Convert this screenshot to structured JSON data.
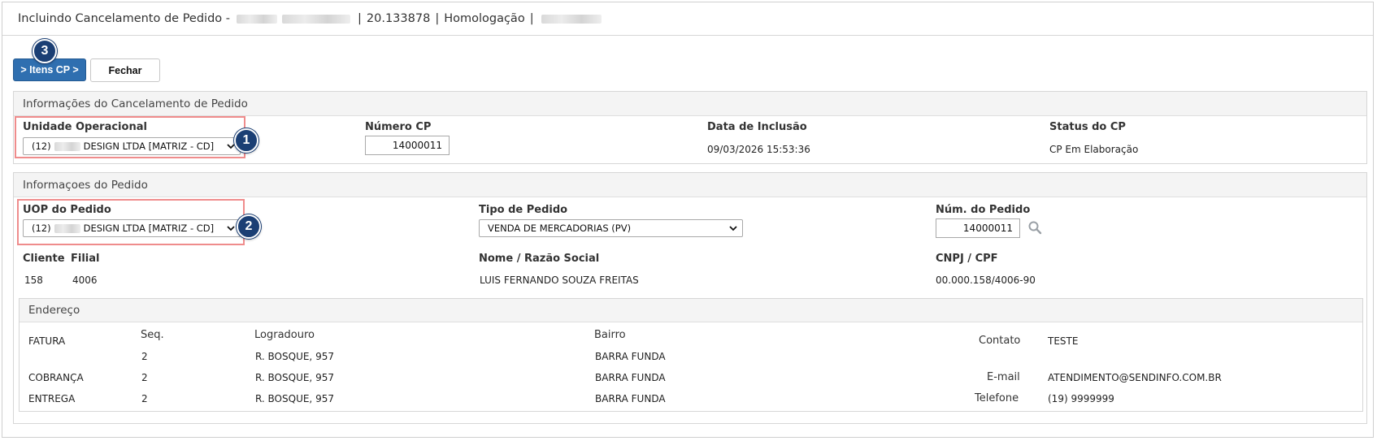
{
  "window": {
    "title_prefix": "Incluindo Cancelamento de Pedido -",
    "title_code": "20.133878",
    "title_env": "Homologação",
    "separator": "|"
  },
  "toolbar": {
    "itens_label": "> Itens CP >",
    "fechar_label": "Fechar",
    "badge_3": "3"
  },
  "cancelamento": {
    "section_title": "Informações do Cancelamento de Pedido",
    "unidade_label": "Unidade Operacional",
    "unidade_value_prefix": "(12)",
    "unidade_value_suffix": "DESIGN LTDA [MATRIZ - CD]",
    "badge_1": "1",
    "numero_label": "Número CP",
    "numero_value": "14000011",
    "data_label": "Data de Inclusão",
    "data_value": "09/03/2026 15:53:36",
    "status_label": "Status do CP",
    "status_value": "CP Em Elaboração"
  },
  "pedido": {
    "section_title": "Informaçoes do Pedido",
    "uop_label": "UOP do Pedido",
    "uop_value_prefix": "(12)",
    "uop_value_suffix": "DESIGN LTDA [MATRIZ - CD]",
    "badge_2": "2",
    "tipo_label": "Tipo de Pedido",
    "tipo_value": "VENDA DE MERCADORIAS (PV)",
    "num_label": "Núm. do Pedido",
    "num_value": "14000011",
    "cliente_label": "Cliente",
    "cliente_value": "158",
    "filial_label": "Filial",
    "filial_value": "4006",
    "nome_label": "Nome / Razão Social",
    "nome_value": "LUIS FERNANDO SOUZA FREITAS",
    "cnpj_label": "CNPJ / CPF",
    "cnpj_value": "00.000.158/4006-90"
  },
  "endereco": {
    "section_title": "Endereço",
    "seq_label": "Seq.",
    "logradouro_label": "Logradouro",
    "bairro_label": "Bairro",
    "rows": [
      {
        "tipo": "FATURA",
        "seq": "2",
        "logradouro": "R. BOSQUE, 957",
        "bairro": "BARRA FUNDA"
      },
      {
        "tipo": "COBRANÇA",
        "seq": "2",
        "logradouro": "R. BOSQUE, 957",
        "bairro": "BARRA FUNDA"
      },
      {
        "tipo": "ENTREGA",
        "seq": "2",
        "logradouro": "R. BOSQUE, 957",
        "bairro": "BARRA FUNDA"
      }
    ],
    "contato_label": "Contato",
    "contato_value": "TESTE",
    "email_label": "E-mail",
    "email_value": "ATENDIMENTO@SENDINFO.COM.BR",
    "telefone_label": "Telefone",
    "telefone_value": "(19) 9999999"
  },
  "colors": {
    "primary": "#2f6fb0",
    "badge": "#1b3f74",
    "highlight": "#ef8c8c"
  },
  "icons": {
    "search": "search-icon",
    "chevron": "chevron-down-icon"
  }
}
